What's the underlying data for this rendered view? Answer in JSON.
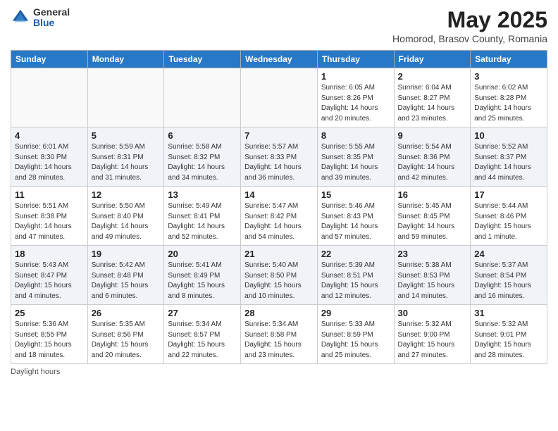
{
  "header": {
    "logo_general": "General",
    "logo_blue": "Blue",
    "month_title": "May 2025",
    "subtitle": "Homorod, Brasov County, Romania"
  },
  "days_of_week": [
    "Sunday",
    "Monday",
    "Tuesday",
    "Wednesday",
    "Thursday",
    "Friday",
    "Saturday"
  ],
  "footer": {
    "daylight_label": "Daylight hours"
  },
  "weeks": [
    [
      {
        "day": "",
        "info": ""
      },
      {
        "day": "",
        "info": ""
      },
      {
        "day": "",
        "info": ""
      },
      {
        "day": "",
        "info": ""
      },
      {
        "day": "1",
        "info": "Sunrise: 6:05 AM\nSunset: 8:26 PM\nDaylight: 14 hours\nand 20 minutes."
      },
      {
        "day": "2",
        "info": "Sunrise: 6:04 AM\nSunset: 8:27 PM\nDaylight: 14 hours\nand 23 minutes."
      },
      {
        "day": "3",
        "info": "Sunrise: 6:02 AM\nSunset: 8:28 PM\nDaylight: 14 hours\nand 25 minutes."
      }
    ],
    [
      {
        "day": "4",
        "info": "Sunrise: 6:01 AM\nSunset: 8:30 PM\nDaylight: 14 hours\nand 28 minutes."
      },
      {
        "day": "5",
        "info": "Sunrise: 5:59 AM\nSunset: 8:31 PM\nDaylight: 14 hours\nand 31 minutes."
      },
      {
        "day": "6",
        "info": "Sunrise: 5:58 AM\nSunset: 8:32 PM\nDaylight: 14 hours\nand 34 minutes."
      },
      {
        "day": "7",
        "info": "Sunrise: 5:57 AM\nSunset: 8:33 PM\nDaylight: 14 hours\nand 36 minutes."
      },
      {
        "day": "8",
        "info": "Sunrise: 5:55 AM\nSunset: 8:35 PM\nDaylight: 14 hours\nand 39 minutes."
      },
      {
        "day": "9",
        "info": "Sunrise: 5:54 AM\nSunset: 8:36 PM\nDaylight: 14 hours\nand 42 minutes."
      },
      {
        "day": "10",
        "info": "Sunrise: 5:52 AM\nSunset: 8:37 PM\nDaylight: 14 hours\nand 44 minutes."
      }
    ],
    [
      {
        "day": "11",
        "info": "Sunrise: 5:51 AM\nSunset: 8:38 PM\nDaylight: 14 hours\nand 47 minutes."
      },
      {
        "day": "12",
        "info": "Sunrise: 5:50 AM\nSunset: 8:40 PM\nDaylight: 14 hours\nand 49 minutes."
      },
      {
        "day": "13",
        "info": "Sunrise: 5:49 AM\nSunset: 8:41 PM\nDaylight: 14 hours\nand 52 minutes."
      },
      {
        "day": "14",
        "info": "Sunrise: 5:47 AM\nSunset: 8:42 PM\nDaylight: 14 hours\nand 54 minutes."
      },
      {
        "day": "15",
        "info": "Sunrise: 5:46 AM\nSunset: 8:43 PM\nDaylight: 14 hours\nand 57 minutes."
      },
      {
        "day": "16",
        "info": "Sunrise: 5:45 AM\nSunset: 8:45 PM\nDaylight: 14 hours\nand 59 minutes."
      },
      {
        "day": "17",
        "info": "Sunrise: 5:44 AM\nSunset: 8:46 PM\nDaylight: 15 hours\nand 1 minute."
      }
    ],
    [
      {
        "day": "18",
        "info": "Sunrise: 5:43 AM\nSunset: 8:47 PM\nDaylight: 15 hours\nand 4 minutes."
      },
      {
        "day": "19",
        "info": "Sunrise: 5:42 AM\nSunset: 8:48 PM\nDaylight: 15 hours\nand 6 minutes."
      },
      {
        "day": "20",
        "info": "Sunrise: 5:41 AM\nSunset: 8:49 PM\nDaylight: 15 hours\nand 8 minutes."
      },
      {
        "day": "21",
        "info": "Sunrise: 5:40 AM\nSunset: 8:50 PM\nDaylight: 15 hours\nand 10 minutes."
      },
      {
        "day": "22",
        "info": "Sunrise: 5:39 AM\nSunset: 8:51 PM\nDaylight: 15 hours\nand 12 minutes."
      },
      {
        "day": "23",
        "info": "Sunrise: 5:38 AM\nSunset: 8:53 PM\nDaylight: 15 hours\nand 14 minutes."
      },
      {
        "day": "24",
        "info": "Sunrise: 5:37 AM\nSunset: 8:54 PM\nDaylight: 15 hours\nand 16 minutes."
      }
    ],
    [
      {
        "day": "25",
        "info": "Sunrise: 5:36 AM\nSunset: 8:55 PM\nDaylight: 15 hours\nand 18 minutes."
      },
      {
        "day": "26",
        "info": "Sunrise: 5:35 AM\nSunset: 8:56 PM\nDaylight: 15 hours\nand 20 minutes."
      },
      {
        "day": "27",
        "info": "Sunrise: 5:34 AM\nSunset: 8:57 PM\nDaylight: 15 hours\nand 22 minutes."
      },
      {
        "day": "28",
        "info": "Sunrise: 5:34 AM\nSunset: 8:58 PM\nDaylight: 15 hours\nand 23 minutes."
      },
      {
        "day": "29",
        "info": "Sunrise: 5:33 AM\nSunset: 8:59 PM\nDaylight: 15 hours\nand 25 minutes."
      },
      {
        "day": "30",
        "info": "Sunrise: 5:32 AM\nSunset: 9:00 PM\nDaylight: 15 hours\nand 27 minutes."
      },
      {
        "day": "31",
        "info": "Sunrise: 5:32 AM\nSunset: 9:01 PM\nDaylight: 15 hours\nand 28 minutes."
      }
    ]
  ]
}
